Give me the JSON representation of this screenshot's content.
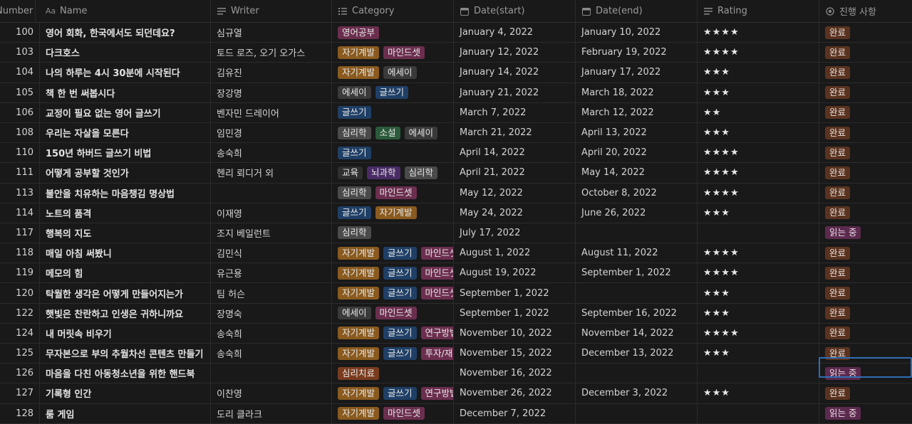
{
  "columns": {
    "number": "Number",
    "name": "Name",
    "name_prefix": "Aa",
    "writer": "Writer",
    "category": "Category",
    "date_start": "Date(start)",
    "date_end": "Date(end)",
    "rating": "Rating",
    "progress": "진행 사항"
  },
  "icons": {
    "writer": "text-lines-icon",
    "category": "list-icon",
    "date_start": "calendar-icon",
    "date_end": "calendar-icon",
    "rating": "text-lines-icon",
    "progress": "status-circle-icon"
  },
  "tag_colors": {
    "영어공부": "#6b2e4e",
    "자기계발": "#8a5a1e",
    "마인드셋": "#6b2e4e",
    "에세이": "#3a3a3a",
    "글쓰기": "#1f3f66",
    "심리학": "#4a4a4a",
    "소설": "#2b5a3a",
    "교육": "#2f2f2f",
    "뇌과학": "#4a2b66",
    "연구방법": "#6b2e4e",
    "투자/재테크": "#6b2e4e",
    "심리치료": "#7a3c1e"
  },
  "status_colors": {
    "완료": "#5a3320",
    "읽는 중": "#5c2a4e"
  },
  "rows": [
    {
      "number": "100",
      "name": "영어 회화, 한국에서도 되던데요?",
      "writer": "심규열",
      "categories": [
        "영어공부"
      ],
      "date_start": "January 4, 2022",
      "date_end": "January 10, 2022",
      "rating": "★★★★",
      "status": "완료"
    },
    {
      "number": "103",
      "name": "다크호스",
      "writer": "토드 로즈, 오기 오가스",
      "categories": [
        "자기계발",
        "마인드셋"
      ],
      "date_start": "January 12, 2022",
      "date_end": "February 19, 2022",
      "rating": "★★★★",
      "status": "완료"
    },
    {
      "number": "104",
      "name": "나의 하루는 4시 30분에 시작된다",
      "writer": "김유진",
      "categories": [
        "자기계발",
        "에세이"
      ],
      "date_start": "January 14, 2022",
      "date_end": "January 17, 2022",
      "rating": "★★★",
      "status": "완료"
    },
    {
      "number": "105",
      "name": "책 한 번 써봅시다",
      "writer": "장강명",
      "categories": [
        "에세이",
        "글쓰기"
      ],
      "date_start": "January 21, 2022",
      "date_end": "March 18, 2022",
      "rating": "★★★",
      "status": "완료"
    },
    {
      "number": "106",
      "name": "교정이 필요 없는 영어 글쓰기",
      "writer": "벤자민 드레이어",
      "categories": [
        "글쓰기"
      ],
      "date_start": "March 7, 2022",
      "date_end": "March 12, 2022",
      "rating": "★★",
      "status": "완료"
    },
    {
      "number": "108",
      "name": "우리는 자살을 모른다",
      "writer": "임민경",
      "categories": [
        "심리학",
        "소설",
        "에세이"
      ],
      "date_start": "March 21, 2022",
      "date_end": "April 13, 2022",
      "rating": "★★★",
      "status": "완료"
    },
    {
      "number": "110",
      "name": "150년 하버드 글쓰기 비법",
      "writer": "송숙희",
      "categories": [
        "글쓰기"
      ],
      "date_start": "April 14, 2022",
      "date_end": "April 20, 2022",
      "rating": "★★★★",
      "status": "완료"
    },
    {
      "number": "111",
      "name": "어떻게 공부할 것인가",
      "writer": "헨리 뢰디거 외",
      "categories": [
        "교육",
        "뇌과학",
        "심리학"
      ],
      "date_start": "April 21, 2022",
      "date_end": "May 14, 2022",
      "rating": "★★★★",
      "status": "완료"
    },
    {
      "number": "113",
      "name": "불안을 치유하는 마음챙김 명상법",
      "writer": "",
      "categories": [
        "심리학",
        "마인드셋"
      ],
      "date_start": "May 12, 2022",
      "date_end": "October 8, 2022",
      "rating": "★★★★",
      "status": "완료"
    },
    {
      "number": "114",
      "name": "노트의 품격",
      "writer": "이재영",
      "categories": [
        "글쓰기",
        "자기계발"
      ],
      "date_start": "May 24, 2022",
      "date_end": "June 26, 2022",
      "rating": "★★★",
      "status": "완료"
    },
    {
      "number": "117",
      "name": "행복의 지도",
      "writer": "조지 베일런트",
      "categories": [
        "심리학"
      ],
      "date_start": "July 17, 2022",
      "date_end": "",
      "rating": "",
      "status": "읽는 중"
    },
    {
      "number": "118",
      "name": "매일 아침 써봤니",
      "writer": "김민식",
      "categories": [
        "자기계발",
        "글쓰기",
        "마인드셋"
      ],
      "date_start": "August 1, 2022",
      "date_end": "August 11, 2022",
      "rating": "★★★★",
      "status": "완료"
    },
    {
      "number": "119",
      "name": "메모의 힘",
      "writer": "유근용",
      "categories": [
        "자기계발",
        "글쓰기",
        "마인드셋"
      ],
      "date_start": "August 19, 2022",
      "date_end": "September 1, 2022",
      "rating": "★★★★",
      "status": "완료"
    },
    {
      "number": "120",
      "name": "탁월한 생각은 어떻게 만들어지는가",
      "writer": "팀 허슨",
      "categories": [
        "자기계발",
        "글쓰기",
        "마인드셋"
      ],
      "date_start": "September 1, 2022",
      "date_end": "",
      "rating": "★★★",
      "status": "완료"
    },
    {
      "number": "122",
      "name": "햇빛은 찬란하고 인생은 귀하니까요",
      "writer": "장명숙",
      "categories": [
        "에세이",
        "마인드셋"
      ],
      "date_start": "September 1, 2022",
      "date_end": "September 16, 2022",
      "rating": "★★★",
      "status": "완료"
    },
    {
      "number": "124",
      "name": "내 머릿속 비우기",
      "writer": "송숙희",
      "categories": [
        "자기계발",
        "글쓰기",
        "연구방법"
      ],
      "date_start": "November 10, 2022",
      "date_end": "November 14, 2022",
      "rating": "★★★★",
      "status": "완료"
    },
    {
      "number": "125",
      "name": "무자본으로 부의 추월차선 콘텐츠 만들기",
      "writer": "송숙희",
      "categories": [
        "자기계발",
        "글쓰기",
        "투자/재테크"
      ],
      "date_start": "November 15, 2022",
      "date_end": "December 13, 2022",
      "rating": "★★★",
      "status": "완료"
    },
    {
      "number": "126",
      "name": "마음을 다친 아동청소년을 위한 핸드북",
      "writer": "",
      "categories": [
        "심리치료"
      ],
      "date_start": "November 16, 2022",
      "date_end": "",
      "rating": "",
      "status": "읽는 중"
    },
    {
      "number": "127",
      "name": "기록형 인간",
      "writer": "이찬영",
      "categories": [
        "자기계발",
        "글쓰기",
        "연구방법"
      ],
      "date_start": "November 26, 2022",
      "date_end": "December 3, 2022",
      "rating": "★★★",
      "status": "완료"
    },
    {
      "number": "128",
      "name": "룸 게임",
      "writer": "도리 클라크",
      "categories": [
        "자기계발",
        "마인드셋"
      ],
      "date_start": "December 7, 2022",
      "date_end": "",
      "rating": "",
      "status": "읽는 중"
    }
  ]
}
